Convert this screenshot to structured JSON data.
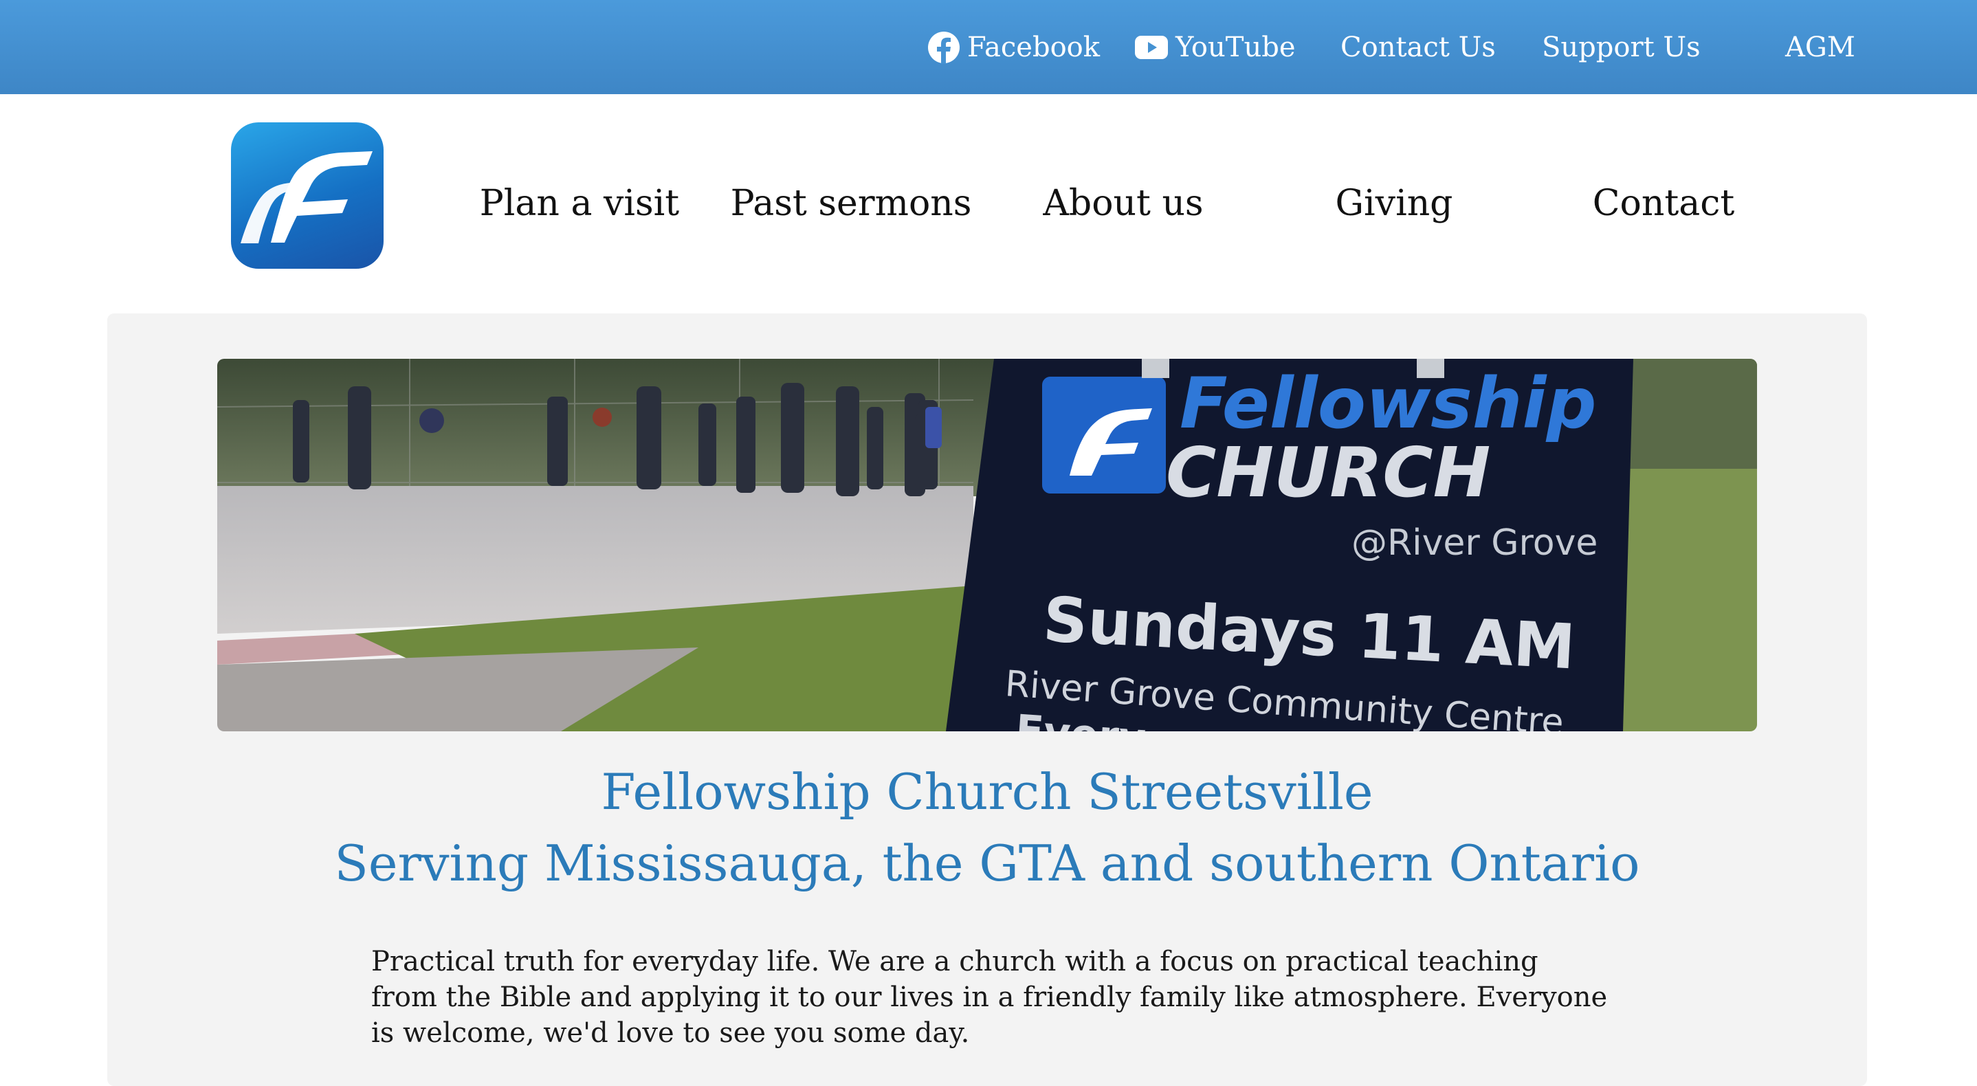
{
  "topbar": {
    "background_color": "#4592d2",
    "links": [
      {
        "label": "Facebook",
        "icon": "facebook-icon"
      },
      {
        "label": "YouTube",
        "icon": "youtube-icon"
      },
      {
        "label": "Contact Us"
      },
      {
        "label": "Support Us"
      },
      {
        "label": "AGM"
      }
    ]
  },
  "header": {
    "logo_icon": "fellowship-church-logo-icon",
    "nav": [
      {
        "label": "Plan a visit"
      },
      {
        "label": "Past sermons"
      },
      {
        "label": "About us"
      },
      {
        "label": "Giving"
      },
      {
        "label": "Contact"
      }
    ]
  },
  "hero": {
    "sign": {
      "line1": "Fellowship",
      "line2": "CHURCH",
      "line3": "@River Grove",
      "line4": "Sundays 11 AM",
      "line5": "River Grove Community Centre",
      "line6": "Every"
    }
  },
  "main": {
    "title_line1": "Fellowship Church Streetsville",
    "title_line2": "Serving Mississauga, the GTA and southern Ontario",
    "intro": "Practical truth for everyday life. We are a church with a focus on practical teaching from the Bible and applying it to our lives in a friendly family like atmosphere. Everyone is welcome, we'd love to see you some day.",
    "title_color": "#2b7bb9"
  }
}
